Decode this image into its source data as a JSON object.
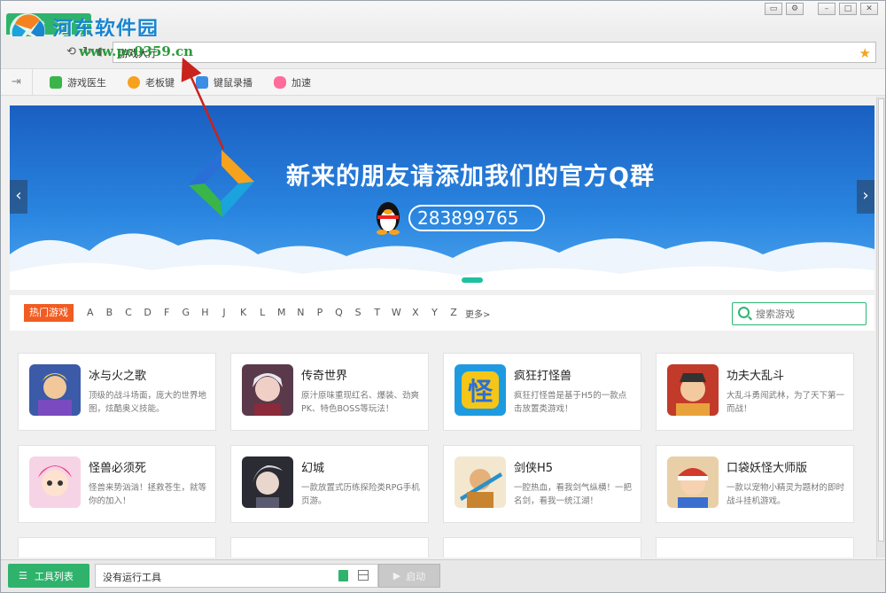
{
  "titlebar": {
    "app_tab": "游戏",
    "watermark": "河东软件园",
    "watermark_url": "www.pc0359.cn"
  },
  "address": {
    "value": "游戏大厅"
  },
  "toolbar": {
    "items": [
      {
        "label": "游戏医生",
        "icon": "medkit-icon",
        "color": "#39b54a"
      },
      {
        "label": "老板键",
        "icon": "eye-icon",
        "color": "#f7a21c"
      },
      {
        "label": "键鼠录播",
        "icon": "keyboard-icon",
        "color": "#3a8ee6"
      },
      {
        "label": "加速",
        "icon": "gamepad-icon",
        "color": "#ff6b9a"
      }
    ]
  },
  "banner": {
    "title": "新来的朋友请添加我们的官方Q群",
    "qq_number": "283899765",
    "prev": "‹",
    "next": "›"
  },
  "filter": {
    "hot": "热门游戏",
    "letters": [
      "A",
      "B",
      "C",
      "D",
      "F",
      "G",
      "H",
      "J",
      "K",
      "L",
      "M",
      "N",
      "P",
      "Q",
      "S",
      "T",
      "W",
      "X",
      "Y",
      "Z"
    ],
    "more": "更多>",
    "search_placeholder": "搜索游戏"
  },
  "games": [
    {
      "title": "冰与火之歌",
      "desc": "顶级的战斗场面，庞大的世界地图，炫酷奥义技能。"
    },
    {
      "title": "传奇世界",
      "desc": "原汁原味重现红名、爆装、劲爽PK、特色BOSS等玩法！"
    },
    {
      "title": "疯狂打怪兽",
      "desc": "疯狂打怪兽是基于H5的一款点击放置类游戏！"
    },
    {
      "title": "功夫大乱斗",
      "desc": "大乱斗勇闯武林，为了天下第一而战！"
    },
    {
      "title": "怪兽必须死",
      "desc": "怪兽来势汹汹！拯救苍生，就等你的加入！"
    },
    {
      "title": "幻城",
      "desc": "一款放置式历练探险类RPG手机页游。"
    },
    {
      "title": "剑侠H5",
      "desc": "一腔热血，看我剑气纵横！一把名剑，看我一统江湖！"
    },
    {
      "title": "口袋妖怪大师版",
      "desc": "一款以宠物小精灵为题材的即时战斗挂机游戏。"
    }
  ],
  "bottombar": {
    "tools_label": "工具列表",
    "status": "没有运行工具",
    "launch_label": "启动"
  }
}
